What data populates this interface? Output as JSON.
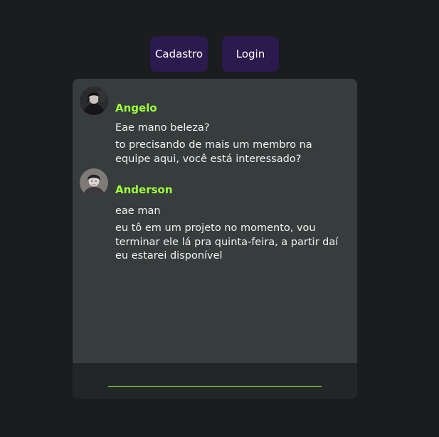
{
  "nav": {
    "cadastro_label": "Cadastro",
    "login_label": "Login"
  },
  "messages": [
    {
      "author": "Angelo",
      "lines": [
        "Eae mano beleza?",
        "to precisando de mais um membro na equipe aqui, você está interessado?"
      ]
    },
    {
      "author": "Anderson",
      "lines": [
        "eae man",
        "eu tô em um projeto no momento, vou terminar ele lá pra quinta-feira, a partir daí eu estarei disponível"
      ]
    }
  ],
  "composer": {
    "value": "",
    "placeholder": ""
  },
  "colors": {
    "background": "#1b1c1e",
    "button_bg": "#2a1a4e",
    "chat_bg": "#373d3d",
    "composer_bg": "#232627",
    "accent": "#9dff3c"
  },
  "icons": {
    "avatar_1": "avatar-image",
    "avatar_2": "avatar-image"
  }
}
